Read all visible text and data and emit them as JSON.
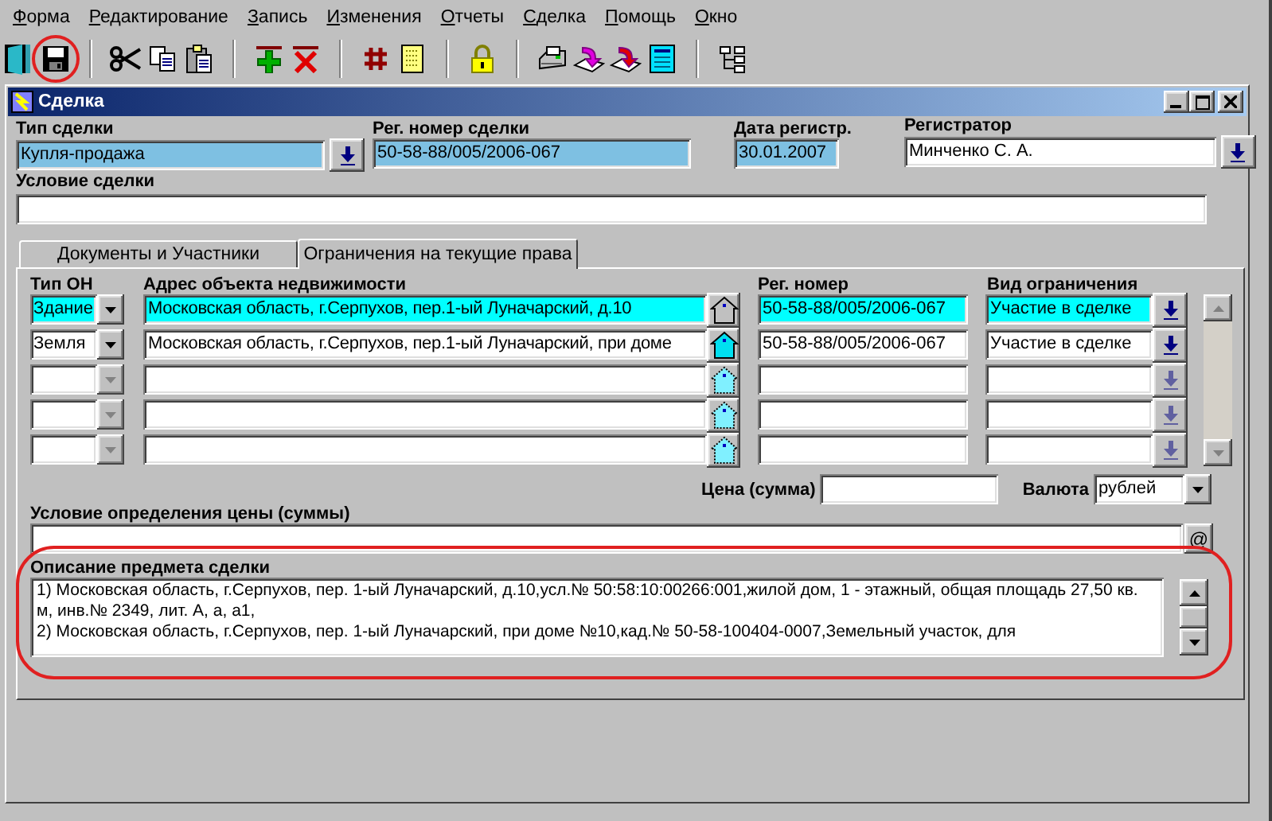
{
  "menu": [
    "Форма",
    "Редактирование",
    "Запись",
    "Изменения",
    "Отчеты",
    "Сделка",
    "Помощь",
    "Окно"
  ],
  "toolbar": [
    [
      {
        "kind": "exit",
        "highlighted": false
      },
      {
        "kind": "save",
        "highlighted": true
      }
    ],
    [
      {
        "kind": "cut",
        "highlighted": false
      },
      {
        "kind": "copy",
        "highlighted": false
      },
      {
        "kind": "paste",
        "highlighted": false
      }
    ],
    [
      {
        "kind": "add",
        "highlighted": false
      },
      {
        "kind": "delete",
        "highlighted": false
      }
    ],
    [
      {
        "kind": "hash",
        "highlighted": false
      },
      {
        "kind": "note",
        "highlighted": false
      }
    ],
    [
      {
        "kind": "lock",
        "highlighted": false
      }
    ],
    [
      {
        "kind": "print",
        "highlighted": false
      },
      {
        "kind": "import",
        "highlighted": false
      },
      {
        "kind": "export",
        "highlighted": false
      },
      {
        "kind": "card",
        "highlighted": false
      }
    ],
    [
      {
        "kind": "tree",
        "highlighted": false
      }
    ]
  ],
  "window": {
    "title": "Сделка"
  },
  "deal_type": {
    "label": "Тип сделки",
    "value": "Купля-продажа",
    "readonly": true
  },
  "reg_number": {
    "label": "Рег. номер сделки",
    "value": "50-58-88/005/2006-067",
    "readonly": true
  },
  "reg_date": {
    "label": "Дата регистр.",
    "value": "30.01.2007",
    "readonly": true
  },
  "registrar": {
    "label": "Регистратор",
    "value": "Минченко С. А.",
    "readonly": false
  },
  "condition": {
    "label": "Условие сделки"
  },
  "tabs": [
    {
      "label": "Документы и Участники",
      "selected": false
    },
    {
      "label": "Ограничения на текущие права",
      "selected": true
    }
  ],
  "table": {
    "columns": [
      "Тип ОН",
      "Адрес объекта недвижимости",
      "Рег. номер",
      "Вид ограничения"
    ],
    "rows": [
      {
        "type": "Здание",
        "address": "Московская область, г.Серпухов, пер.1-ый Луначарский, д.10",
        "reg": "50-58-88/005/2006-067",
        "restriction": "Участие в сделке",
        "selected": true,
        "enabled": true
      },
      {
        "type": "Земля",
        "address": "Московская область, г.Серпухов, пер.1-ый Луначарский, при доме",
        "reg": "50-58-88/005/2006-067",
        "restriction": "Участие в сделке",
        "selected": false,
        "enabled": true
      },
      {
        "selected": false,
        "enabled": false
      },
      {
        "selected": false,
        "enabled": false
      },
      {
        "selected": false,
        "enabled": false
      }
    ]
  },
  "price": {
    "label": "Цена (сумма)"
  },
  "currency": {
    "label": "Валюта",
    "value": "рублей"
  },
  "price_condition": {
    "label": "Условие определения цены (суммы)",
    "button": "@"
  },
  "description": {
    "label": "Описание предмета сделки",
    "highlighted": true,
    "items": [
      "1) Московская область, г.Серпухов, пер. 1-ый Луначарский, д.10,усл.№ 50:58:10:00266:001,жилой дом, 1 - этажный, общая площадь 27,50 кв. м, инв.№ 2349, лит. А, а, а1,",
      "2) Московская область, г.Серпухов, пер. 1-ый Луначарский, при доме №10,кад.№ 50-58-100404-0007,Земельный участок, для"
    ]
  }
}
